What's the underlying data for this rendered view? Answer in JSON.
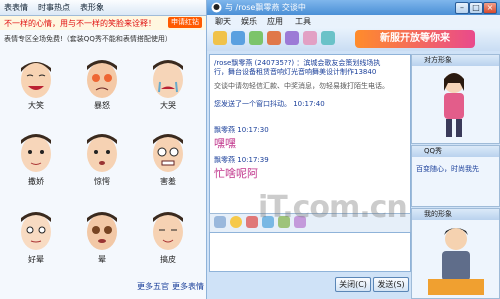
{
  "left_panel": {
    "tabs": [
      "表表情",
      "时事热点",
      "表形象"
    ],
    "promo_text": "不一样的心情，用与不一样的笑脸来诠释！",
    "promo_button": "申请红钻",
    "notice": "表情专区全场免费!（套装QQ秀不能和表情搭配使用）",
    "faces": [
      {
        "label": "大笑"
      },
      {
        "label": "暴怒"
      },
      {
        "label": "大哭"
      },
      {
        "label": "撒娇"
      },
      {
        "label": "惊愕"
      },
      {
        "label": "害羞"
      },
      {
        "label": "好晕"
      },
      {
        "label": "晕"
      },
      {
        "label": "搞皮"
      }
    ],
    "more_left": "更多五官",
    "more_right": "更多表情"
  },
  "window": {
    "title": "与 /rose飘零燕 交谈中",
    "menu": [
      "聊天",
      "娱乐",
      "应用",
      "工具"
    ],
    "banner": "新服开放等你来",
    "messages": [
      {
        "line1": "/rose飘零燕 (240735??) ：滨城会歌友会策划线场执",
        "line2": "行，舞台设备租赁音响灯光音响舞美设计制作13840"
      },
      {
        "system": "交谈中请勿轻信汇款、中奖消息，勿轻易拨打陌生电话。"
      },
      {
        "system": "您发送了一个窗口抖动。 10:17:40"
      },
      {
        "sender": "飘零燕",
        "time": "10:17:30",
        "text": "嘿嘿"
      },
      {
        "sender": "飘零燕",
        "time": "10:17:39",
        "text": "忙啥呢阿"
      }
    ],
    "close_button": "关闭(C)",
    "send_button": "发送(S)",
    "side_top": "对方形象",
    "side_mid_title": "QQ秀",
    "side_mid_text": "百变随心，时尚我先",
    "side_bottom": "我的形象",
    "watermark": "iT.com.cn"
  },
  "colors": {
    "accent": "#4a8fd6",
    "promo_red": "#e01010",
    "msg_pink": "#c0348b"
  }
}
